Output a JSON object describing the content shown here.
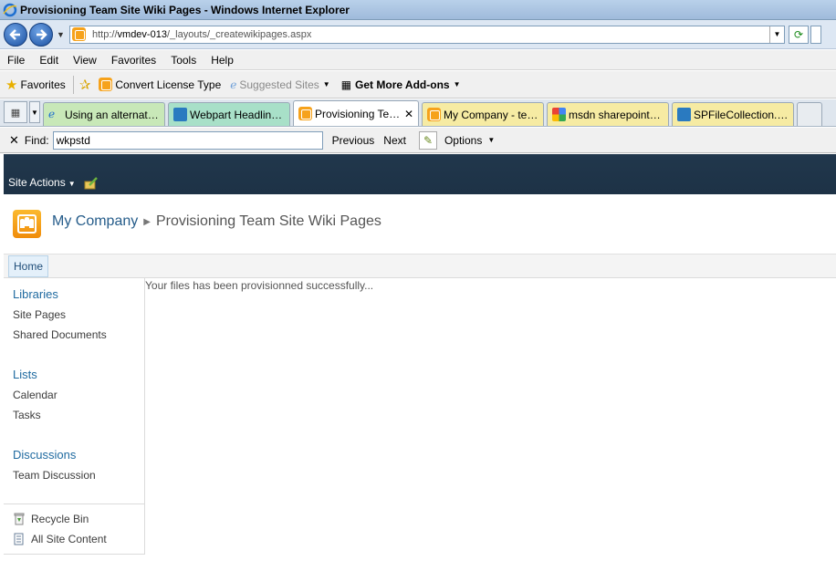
{
  "window": {
    "title": "Provisioning Team Site Wiki Pages - Windows Internet Explorer"
  },
  "address": {
    "url_prefix": "http://",
    "url_host": "vmdev-013",
    "url_path": "/_layouts/_createwikipages.aspx"
  },
  "menu": [
    "File",
    "Edit",
    "View",
    "Favorites",
    "Tools",
    "Help"
  ],
  "favorites_bar": {
    "favorites_label": "Favorites",
    "convert_label": "Convert License Type",
    "suggested_label": "Suggested Sites",
    "addons_label": "Get More Add-ons"
  },
  "tabs": [
    {
      "label": "Using an alternate C..."
    },
    {
      "label": "Webpart Headline h..."
    },
    {
      "label": "Provisioning Tea..."
    },
    {
      "label": "My Company - test css"
    },
    {
      "label": "msdn sharepoint spf..."
    },
    {
      "label": "SPFileCollection.Add..."
    }
  ],
  "find": {
    "label": "Find:",
    "value": "wkpstd",
    "previous": "Previous",
    "next": "Next",
    "options": "Options"
  },
  "sharepoint": {
    "site_actions": "Site Actions",
    "site_name": "My Company",
    "page_title": "Provisioning Team Site Wiki Pages",
    "topnav_home": "Home",
    "quicklaunch": {
      "libraries": "Libraries",
      "site_pages": "Site Pages",
      "shared_documents": "Shared Documents",
      "lists": "Lists",
      "calendar": "Calendar",
      "tasks": "Tasks",
      "discussions": "Discussions",
      "team_discussion": "Team Discussion",
      "recycle_bin": "Recycle Bin",
      "all_site_content": "All Site Content"
    },
    "message": "Your files has been provisionned successfully..."
  }
}
